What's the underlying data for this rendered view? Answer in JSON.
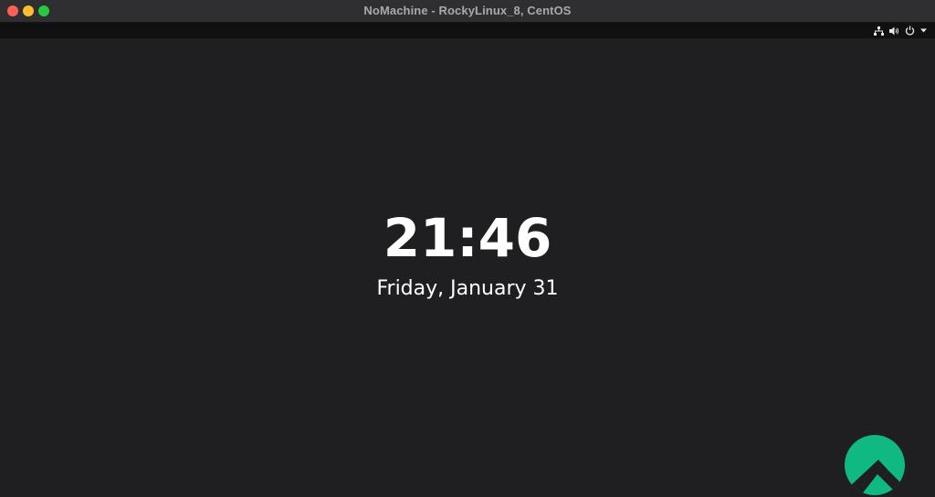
{
  "window": {
    "title": "NoMachine - RockyLinux_8, CentOS"
  },
  "topbar": {
    "icons": [
      "network-icon",
      "volume-icon",
      "power-icon",
      "chevron-down-icon"
    ]
  },
  "lock_screen": {
    "time": "21:46",
    "date": "Friday, January 31"
  },
  "logo": {
    "name": "rocky-linux-logo",
    "color": "#10b981"
  },
  "colors": {
    "background": "#1f1f21",
    "titlebar": "#2f2e30",
    "topbar": "#111112",
    "close": "#ff5f57",
    "minimize": "#febc2e",
    "maximize": "#28c840"
  }
}
